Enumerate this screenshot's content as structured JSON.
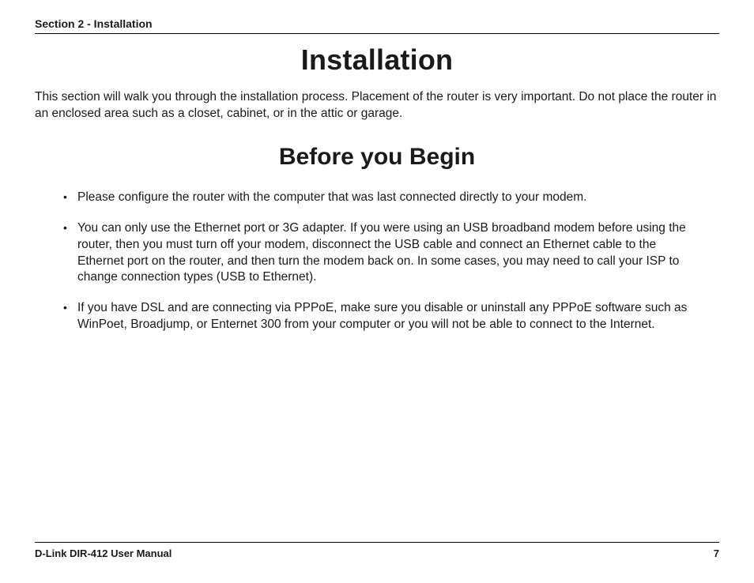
{
  "header": {
    "section_label": "Section 2 - Installation"
  },
  "titles": {
    "main": "Installation",
    "sub": "Before you Begin"
  },
  "intro": "This section will walk you through the installation process. Placement of the router is very important. Do not place the router in an enclosed area such as a closet, cabinet, or in the attic or garage.",
  "bullets": [
    "Please configure the router with the computer that was last connected directly to your modem.",
    "You can only use the Ethernet port or 3G adapter. If you were using an USB broadband modem before using the router, then you must turn off your modem, disconnect the USB cable and connect an Ethernet cable to the Ethernet port on the router, and then turn the modem back on. In some cases, you may need to call your ISP to change connection types (USB to Ethernet).",
    "If you have DSL and are connecting via PPPoE, make sure you disable or uninstall any PPPoE software such as WinPoet, Broadjump, or Enternet 300 from your computer or you will not be able to connect to the Internet."
  ],
  "footer": {
    "manual": "D-Link DIR-412 User Manual",
    "page": "7"
  }
}
